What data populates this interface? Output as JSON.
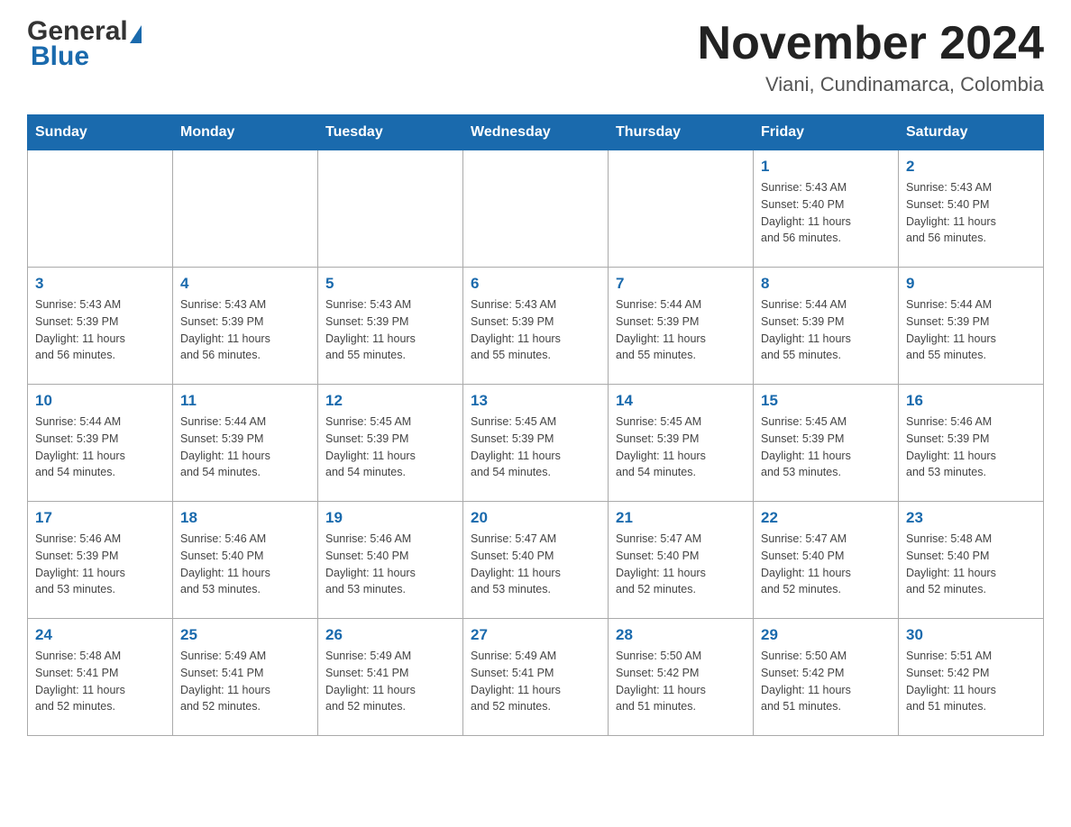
{
  "header": {
    "logo": {
      "general": "General",
      "blue": "Blue"
    },
    "title": "November 2024",
    "subtitle": "Viani, Cundinamarca, Colombia"
  },
  "calendar": {
    "days_of_week": [
      "Sunday",
      "Monday",
      "Tuesday",
      "Wednesday",
      "Thursday",
      "Friday",
      "Saturday"
    ],
    "weeks": [
      [
        {
          "day": "",
          "info": ""
        },
        {
          "day": "",
          "info": ""
        },
        {
          "day": "",
          "info": ""
        },
        {
          "day": "",
          "info": ""
        },
        {
          "day": "",
          "info": ""
        },
        {
          "day": "1",
          "info": "Sunrise: 5:43 AM\nSunset: 5:40 PM\nDaylight: 11 hours\nand 56 minutes."
        },
        {
          "day": "2",
          "info": "Sunrise: 5:43 AM\nSunset: 5:40 PM\nDaylight: 11 hours\nand 56 minutes."
        }
      ],
      [
        {
          "day": "3",
          "info": "Sunrise: 5:43 AM\nSunset: 5:39 PM\nDaylight: 11 hours\nand 56 minutes."
        },
        {
          "day": "4",
          "info": "Sunrise: 5:43 AM\nSunset: 5:39 PM\nDaylight: 11 hours\nand 56 minutes."
        },
        {
          "day": "5",
          "info": "Sunrise: 5:43 AM\nSunset: 5:39 PM\nDaylight: 11 hours\nand 55 minutes."
        },
        {
          "day": "6",
          "info": "Sunrise: 5:43 AM\nSunset: 5:39 PM\nDaylight: 11 hours\nand 55 minutes."
        },
        {
          "day": "7",
          "info": "Sunrise: 5:44 AM\nSunset: 5:39 PM\nDaylight: 11 hours\nand 55 minutes."
        },
        {
          "day": "8",
          "info": "Sunrise: 5:44 AM\nSunset: 5:39 PM\nDaylight: 11 hours\nand 55 minutes."
        },
        {
          "day": "9",
          "info": "Sunrise: 5:44 AM\nSunset: 5:39 PM\nDaylight: 11 hours\nand 55 minutes."
        }
      ],
      [
        {
          "day": "10",
          "info": "Sunrise: 5:44 AM\nSunset: 5:39 PM\nDaylight: 11 hours\nand 54 minutes."
        },
        {
          "day": "11",
          "info": "Sunrise: 5:44 AM\nSunset: 5:39 PM\nDaylight: 11 hours\nand 54 minutes."
        },
        {
          "day": "12",
          "info": "Sunrise: 5:45 AM\nSunset: 5:39 PM\nDaylight: 11 hours\nand 54 minutes."
        },
        {
          "day": "13",
          "info": "Sunrise: 5:45 AM\nSunset: 5:39 PM\nDaylight: 11 hours\nand 54 minutes."
        },
        {
          "day": "14",
          "info": "Sunrise: 5:45 AM\nSunset: 5:39 PM\nDaylight: 11 hours\nand 54 minutes."
        },
        {
          "day": "15",
          "info": "Sunrise: 5:45 AM\nSunset: 5:39 PM\nDaylight: 11 hours\nand 53 minutes."
        },
        {
          "day": "16",
          "info": "Sunrise: 5:46 AM\nSunset: 5:39 PM\nDaylight: 11 hours\nand 53 minutes."
        }
      ],
      [
        {
          "day": "17",
          "info": "Sunrise: 5:46 AM\nSunset: 5:39 PM\nDaylight: 11 hours\nand 53 minutes."
        },
        {
          "day": "18",
          "info": "Sunrise: 5:46 AM\nSunset: 5:40 PM\nDaylight: 11 hours\nand 53 minutes."
        },
        {
          "day": "19",
          "info": "Sunrise: 5:46 AM\nSunset: 5:40 PM\nDaylight: 11 hours\nand 53 minutes."
        },
        {
          "day": "20",
          "info": "Sunrise: 5:47 AM\nSunset: 5:40 PM\nDaylight: 11 hours\nand 53 minutes."
        },
        {
          "day": "21",
          "info": "Sunrise: 5:47 AM\nSunset: 5:40 PM\nDaylight: 11 hours\nand 52 minutes."
        },
        {
          "day": "22",
          "info": "Sunrise: 5:47 AM\nSunset: 5:40 PM\nDaylight: 11 hours\nand 52 minutes."
        },
        {
          "day": "23",
          "info": "Sunrise: 5:48 AM\nSunset: 5:40 PM\nDaylight: 11 hours\nand 52 minutes."
        }
      ],
      [
        {
          "day": "24",
          "info": "Sunrise: 5:48 AM\nSunset: 5:41 PM\nDaylight: 11 hours\nand 52 minutes."
        },
        {
          "day": "25",
          "info": "Sunrise: 5:49 AM\nSunset: 5:41 PM\nDaylight: 11 hours\nand 52 minutes."
        },
        {
          "day": "26",
          "info": "Sunrise: 5:49 AM\nSunset: 5:41 PM\nDaylight: 11 hours\nand 52 minutes."
        },
        {
          "day": "27",
          "info": "Sunrise: 5:49 AM\nSunset: 5:41 PM\nDaylight: 11 hours\nand 52 minutes."
        },
        {
          "day": "28",
          "info": "Sunrise: 5:50 AM\nSunset: 5:42 PM\nDaylight: 11 hours\nand 51 minutes."
        },
        {
          "day": "29",
          "info": "Sunrise: 5:50 AM\nSunset: 5:42 PM\nDaylight: 11 hours\nand 51 minutes."
        },
        {
          "day": "30",
          "info": "Sunrise: 5:51 AM\nSunset: 5:42 PM\nDaylight: 11 hours\nand 51 minutes."
        }
      ]
    ]
  }
}
